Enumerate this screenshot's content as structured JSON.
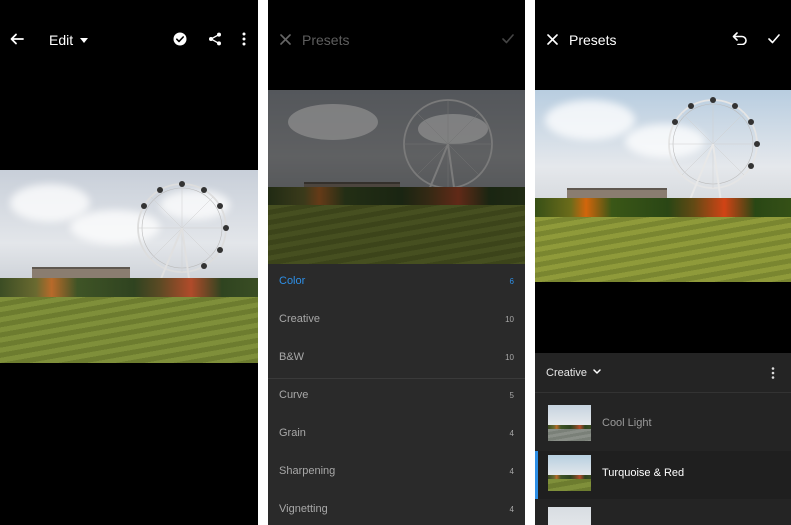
{
  "screen1": {
    "title": "Edit",
    "icons": [
      "back-arrow-icon",
      "caret-down-icon",
      "check-circle-icon",
      "share-icon",
      "more-vertical-icon"
    ]
  },
  "screen2": {
    "title": "Presets",
    "categories": [
      {
        "label": "Color",
        "count": "6",
        "active": true
      },
      {
        "label": "Creative",
        "count": "10"
      },
      {
        "label": "B&W",
        "count": "10"
      },
      {
        "label": "Curve",
        "count": "5"
      },
      {
        "label": "Grain",
        "count": "4"
      },
      {
        "label": "Sharpening",
        "count": "4"
      },
      {
        "label": "Vignetting",
        "count": "4"
      }
    ],
    "icons": [
      "close-icon",
      "check-icon"
    ]
  },
  "screen3": {
    "title": "Presets",
    "category": "Creative",
    "presets": [
      {
        "label": "Cool Light"
      },
      {
        "label": "Turquoise & Red",
        "selected": true
      }
    ],
    "icons": [
      "close-icon",
      "undo-icon",
      "check-icon",
      "chevron-down-icon",
      "more-vertical-icon"
    ]
  },
  "colors": {
    "accent": "#2e8fe6",
    "background": "#000000",
    "list_background": "#2a2a2a",
    "text_dim": "#a8a8a8"
  }
}
